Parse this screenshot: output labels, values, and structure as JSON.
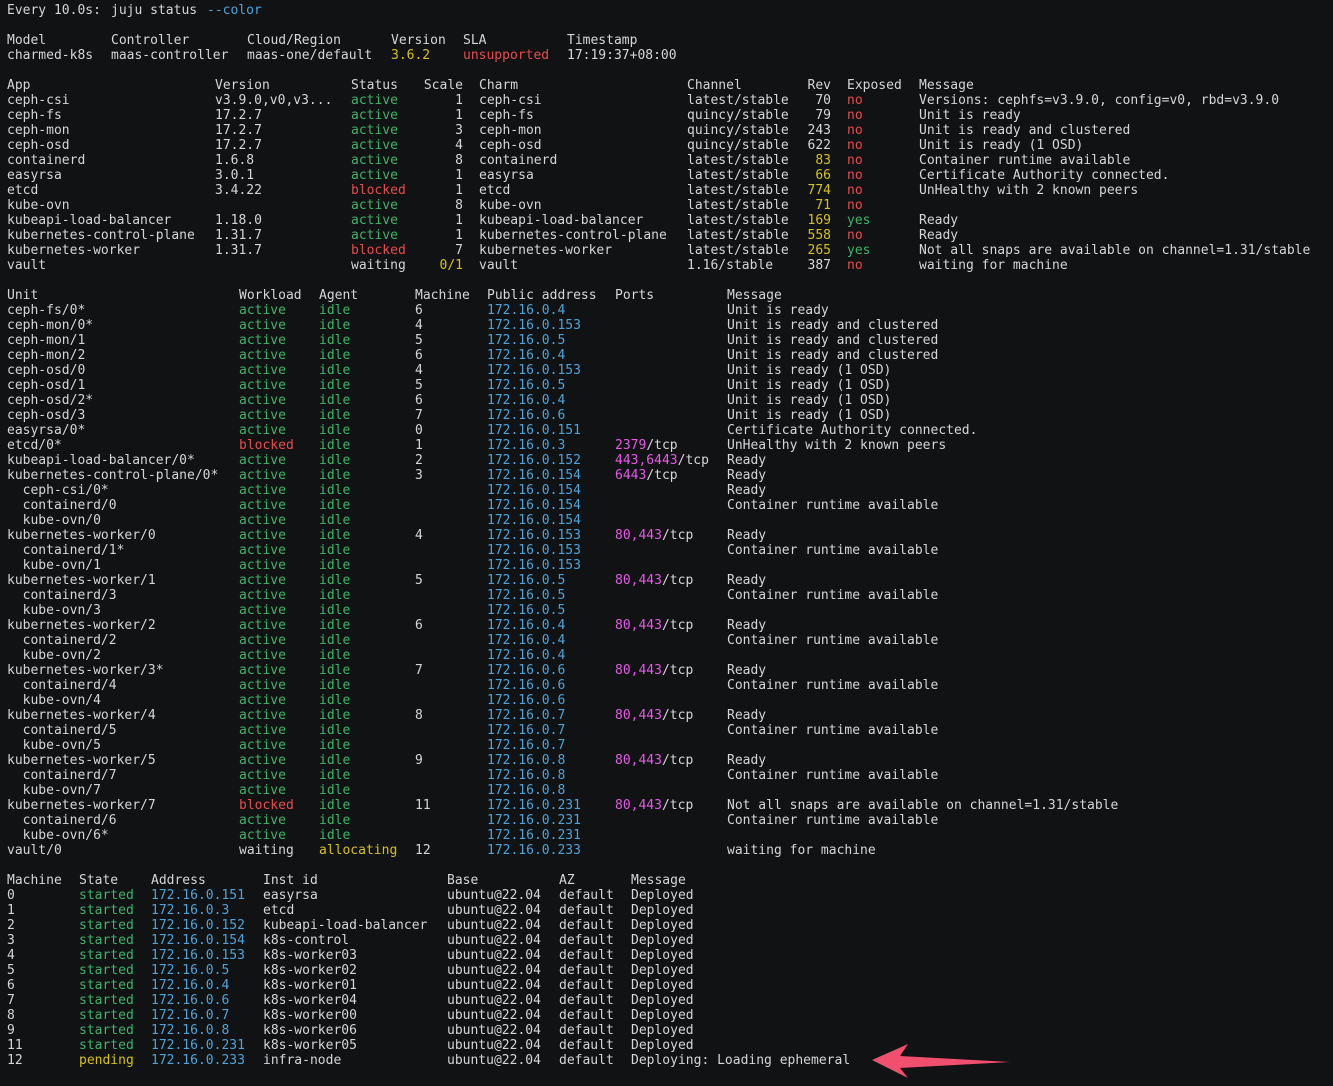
{
  "header": {
    "watch": "Every 10.0s: ",
    "command": "juju status ",
    "flag": "--color"
  },
  "model": {
    "headers": [
      "Model",
      "Controller",
      "Cloud/Region",
      "Version",
      "SLA",
      "Timestamp"
    ],
    "values": [
      "charmed-k8s",
      "maas-controller",
      "maas-one/default",
      "3.6.2",
      "unsupported",
      "17:19:37+08:00"
    ]
  },
  "apps": {
    "headers": [
      "App",
      "Version",
      "Status",
      "Scale",
      "Charm",
      "Channel",
      "Rev",
      "Exposed",
      "Message"
    ],
    "rows": [
      {
        "app": "ceph-csi",
        "version": "v3.9.0,v0,v3...",
        "status": "active",
        "scale": "1",
        "charm": "ceph-csi",
        "channel": "latest/stable",
        "rev": "70",
        "exposed": "no",
        "message": "Versions: cephfs=v3.9.0, config=v0, rbd=v3.9.0"
      },
      {
        "app": "ceph-fs",
        "version": "17.2.7",
        "status": "active",
        "scale": "1",
        "charm": "ceph-fs",
        "channel": "quincy/stable",
        "rev": "79",
        "exposed": "no",
        "message": "Unit is ready"
      },
      {
        "app": "ceph-mon",
        "version": "17.2.7",
        "status": "active",
        "scale": "3",
        "charm": "ceph-mon",
        "channel": "quincy/stable",
        "rev": "243",
        "exposed": "no",
        "message": "Unit is ready and clustered"
      },
      {
        "app": "ceph-osd",
        "version": "17.2.7",
        "status": "active",
        "scale": "4",
        "charm": "ceph-osd",
        "channel": "quincy/stable",
        "rev": "622",
        "exposed": "no",
        "message": "Unit is ready (1 OSD)"
      },
      {
        "app": "containerd",
        "version": "1.6.8",
        "status": "active",
        "scale": "8",
        "charm": "containerd",
        "channel": "latest/stable",
        "rev": "83",
        "exposed": "no",
        "message": "Container runtime available"
      },
      {
        "app": "easyrsa",
        "version": "3.0.1",
        "status": "active",
        "scale": "1",
        "charm": "easyrsa",
        "channel": "latest/stable",
        "rev": "66",
        "exposed": "no",
        "message": "Certificate Authority connected."
      },
      {
        "app": "etcd",
        "version": "3.4.22",
        "status": "blocked",
        "scale": "1",
        "charm": "etcd",
        "channel": "latest/stable",
        "rev": "774",
        "exposed": "no",
        "message": "UnHealthy with 2 known peers"
      },
      {
        "app": "kube-ovn",
        "version": "",
        "status": "active",
        "scale": "8",
        "charm": "kube-ovn",
        "channel": "latest/stable",
        "rev": "71",
        "exposed": "no",
        "message": ""
      },
      {
        "app": "kubeapi-load-balancer",
        "version": "1.18.0",
        "status": "active",
        "scale": "1",
        "charm": "kubeapi-load-balancer",
        "channel": "latest/stable",
        "rev": "169",
        "exposed": "yes",
        "message": "Ready"
      },
      {
        "app": "kubernetes-control-plane",
        "version": "1.31.7",
        "status": "active",
        "scale": "1",
        "charm": "kubernetes-control-plane",
        "channel": "latest/stable",
        "rev": "558",
        "exposed": "no",
        "message": "Ready"
      },
      {
        "app": "kubernetes-worker",
        "version": "1.31.7",
        "status": "blocked",
        "scale": "7",
        "charm": "kubernetes-worker",
        "channel": "latest/stable",
        "rev": "265",
        "exposed": "yes",
        "message": "Not all snaps are available on channel=1.31/stable"
      },
      {
        "app": "vault",
        "version": "",
        "status": "waiting",
        "scale": "0/1",
        "charm": "vault",
        "channel": "1.16/stable",
        "rev": "387",
        "exposed": "no",
        "message": "waiting for machine"
      }
    ]
  },
  "units": {
    "headers": [
      "Unit",
      "Workload",
      "Agent",
      "Machine",
      "Public address",
      "Ports",
      "Message"
    ],
    "rows": [
      {
        "unit": "ceph-fs/0*",
        "workload": "active",
        "agent": "idle",
        "machine": "6",
        "address": "172.16.0.4",
        "ports_num": "",
        "ports_proto": "",
        "message": "Unit is ready"
      },
      {
        "unit": "ceph-mon/0*",
        "workload": "active",
        "agent": "idle",
        "machine": "4",
        "address": "172.16.0.153",
        "ports_num": "",
        "ports_proto": "",
        "message": "Unit is ready and clustered"
      },
      {
        "unit": "ceph-mon/1",
        "workload": "active",
        "agent": "idle",
        "machine": "5",
        "address": "172.16.0.5",
        "ports_num": "",
        "ports_proto": "",
        "message": "Unit is ready and clustered"
      },
      {
        "unit": "ceph-mon/2",
        "workload": "active",
        "agent": "idle",
        "machine": "6",
        "address": "172.16.0.4",
        "ports_num": "",
        "ports_proto": "",
        "message": "Unit is ready and clustered"
      },
      {
        "unit": "ceph-osd/0",
        "workload": "active",
        "agent": "idle",
        "machine": "4",
        "address": "172.16.0.153",
        "ports_num": "",
        "ports_proto": "",
        "message": "Unit is ready (1 OSD)"
      },
      {
        "unit": "ceph-osd/1",
        "workload": "active",
        "agent": "idle",
        "machine": "5",
        "address": "172.16.0.5",
        "ports_num": "",
        "ports_proto": "",
        "message": "Unit is ready (1 OSD)"
      },
      {
        "unit": "ceph-osd/2*",
        "workload": "active",
        "agent": "idle",
        "machine": "6",
        "address": "172.16.0.4",
        "ports_num": "",
        "ports_proto": "",
        "message": "Unit is ready (1 OSD)"
      },
      {
        "unit": "ceph-osd/3",
        "workload": "active",
        "agent": "idle",
        "machine": "7",
        "address": "172.16.0.6",
        "ports_num": "",
        "ports_proto": "",
        "message": "Unit is ready (1 OSD)"
      },
      {
        "unit": "easyrsa/0*",
        "workload": "active",
        "agent": "idle",
        "machine": "0",
        "address": "172.16.0.151",
        "ports_num": "",
        "ports_proto": "",
        "message": "Certificate Authority connected."
      },
      {
        "unit": "etcd/0*",
        "workload": "blocked",
        "agent": "idle",
        "machine": "1",
        "address": "172.16.0.3",
        "ports_num": "2379",
        "ports_proto": "/tcp",
        "message": "UnHealthy with 2 known peers"
      },
      {
        "unit": "kubeapi-load-balancer/0*",
        "workload": "active",
        "agent": "idle",
        "machine": "2",
        "address": "172.16.0.152",
        "ports_num": "443,6443",
        "ports_proto": "/tcp",
        "message": "Ready"
      },
      {
        "unit": "kubernetes-control-plane/0*",
        "workload": "active",
        "agent": "idle",
        "machine": "3",
        "address": "172.16.0.154",
        "ports_num": "6443",
        "ports_proto": "/tcp",
        "message": "Ready"
      },
      {
        "unit": "  ceph-csi/0*",
        "workload": "active",
        "agent": "idle",
        "machine": "",
        "address": "172.16.0.154",
        "ports_num": "",
        "ports_proto": "",
        "message": "Ready"
      },
      {
        "unit": "  containerd/0",
        "workload": "active",
        "agent": "idle",
        "machine": "",
        "address": "172.16.0.154",
        "ports_num": "",
        "ports_proto": "",
        "message": "Container runtime available"
      },
      {
        "unit": "  kube-ovn/0",
        "workload": "active",
        "agent": "idle",
        "machine": "",
        "address": "172.16.0.154",
        "ports_num": "",
        "ports_proto": "",
        "message": ""
      },
      {
        "unit": "kubernetes-worker/0",
        "workload": "active",
        "agent": "idle",
        "machine": "4",
        "address": "172.16.0.153",
        "ports_num": "80,443",
        "ports_proto": "/tcp",
        "message": "Ready"
      },
      {
        "unit": "  containerd/1*",
        "workload": "active",
        "agent": "idle",
        "machine": "",
        "address": "172.16.0.153",
        "ports_num": "",
        "ports_proto": "",
        "message": "Container runtime available"
      },
      {
        "unit": "  kube-ovn/1",
        "workload": "active",
        "agent": "idle",
        "machine": "",
        "address": "172.16.0.153",
        "ports_num": "",
        "ports_proto": "",
        "message": ""
      },
      {
        "unit": "kubernetes-worker/1",
        "workload": "active",
        "agent": "idle",
        "machine": "5",
        "address": "172.16.0.5",
        "ports_num": "80,443",
        "ports_proto": "/tcp",
        "message": "Ready"
      },
      {
        "unit": "  containerd/3",
        "workload": "active",
        "agent": "idle",
        "machine": "",
        "address": "172.16.0.5",
        "ports_num": "",
        "ports_proto": "",
        "message": "Container runtime available"
      },
      {
        "unit": "  kube-ovn/3",
        "workload": "active",
        "agent": "idle",
        "machine": "",
        "address": "172.16.0.5",
        "ports_num": "",
        "ports_proto": "",
        "message": ""
      },
      {
        "unit": "kubernetes-worker/2",
        "workload": "active",
        "agent": "idle",
        "machine": "6",
        "address": "172.16.0.4",
        "ports_num": "80,443",
        "ports_proto": "/tcp",
        "message": "Ready"
      },
      {
        "unit": "  containerd/2",
        "workload": "active",
        "agent": "idle",
        "machine": "",
        "address": "172.16.0.4",
        "ports_num": "",
        "ports_proto": "",
        "message": "Container runtime available"
      },
      {
        "unit": "  kube-ovn/2",
        "workload": "active",
        "agent": "idle",
        "machine": "",
        "address": "172.16.0.4",
        "ports_num": "",
        "ports_proto": "",
        "message": ""
      },
      {
        "unit": "kubernetes-worker/3*",
        "workload": "active",
        "agent": "idle",
        "machine": "7",
        "address": "172.16.0.6",
        "ports_num": "80,443",
        "ports_proto": "/tcp",
        "message": "Ready"
      },
      {
        "unit": "  containerd/4",
        "workload": "active",
        "agent": "idle",
        "machine": "",
        "address": "172.16.0.6",
        "ports_num": "",
        "ports_proto": "",
        "message": "Container runtime available"
      },
      {
        "unit": "  kube-ovn/4",
        "workload": "active",
        "agent": "idle",
        "machine": "",
        "address": "172.16.0.6",
        "ports_num": "",
        "ports_proto": "",
        "message": ""
      },
      {
        "unit": "kubernetes-worker/4",
        "workload": "active",
        "agent": "idle",
        "machine": "8",
        "address": "172.16.0.7",
        "ports_num": "80,443",
        "ports_proto": "/tcp",
        "message": "Ready"
      },
      {
        "unit": "  containerd/5",
        "workload": "active",
        "agent": "idle",
        "machine": "",
        "address": "172.16.0.7",
        "ports_num": "",
        "ports_proto": "",
        "message": "Container runtime available"
      },
      {
        "unit": "  kube-ovn/5",
        "workload": "active",
        "agent": "idle",
        "machine": "",
        "address": "172.16.0.7",
        "ports_num": "",
        "ports_proto": "",
        "message": ""
      },
      {
        "unit": "kubernetes-worker/5",
        "workload": "active",
        "agent": "idle",
        "machine": "9",
        "address": "172.16.0.8",
        "ports_num": "80,443",
        "ports_proto": "/tcp",
        "message": "Ready"
      },
      {
        "unit": "  containerd/7",
        "workload": "active",
        "agent": "idle",
        "machine": "",
        "address": "172.16.0.8",
        "ports_num": "",
        "ports_proto": "",
        "message": "Container runtime available"
      },
      {
        "unit": "  kube-ovn/7",
        "workload": "active",
        "agent": "idle",
        "machine": "",
        "address": "172.16.0.8",
        "ports_num": "",
        "ports_proto": "",
        "message": ""
      },
      {
        "unit": "kubernetes-worker/7",
        "workload": "blocked",
        "agent": "idle",
        "machine": "11",
        "address": "172.16.0.231",
        "ports_num": "80,443",
        "ports_proto": "/tcp",
        "message": "Not all snaps are available on channel=1.31/stable"
      },
      {
        "unit": "  containerd/6",
        "workload": "active",
        "agent": "idle",
        "machine": "",
        "address": "172.16.0.231",
        "ports_num": "",
        "ports_proto": "",
        "message": "Container runtime available"
      },
      {
        "unit": "  kube-ovn/6*",
        "workload": "active",
        "agent": "idle",
        "machine": "",
        "address": "172.16.0.231",
        "ports_num": "",
        "ports_proto": "",
        "message": ""
      },
      {
        "unit": "vault/0",
        "workload": "waiting",
        "agent": "allocating",
        "machine": "12",
        "address": "172.16.0.233",
        "ports_num": "",
        "ports_proto": "",
        "message": "waiting for machine"
      }
    ]
  },
  "machines": {
    "headers": [
      "Machine",
      "State",
      "Address",
      "Inst id",
      "Base",
      "AZ",
      "Message"
    ],
    "rows": [
      {
        "machine": "0",
        "state": "started",
        "address": "172.16.0.151",
        "inst": "easyrsa",
        "base": "ubuntu@22.04",
        "az": "default",
        "message": "Deployed"
      },
      {
        "machine": "1",
        "state": "started",
        "address": "172.16.0.3",
        "inst": "etcd",
        "base": "ubuntu@22.04",
        "az": "default",
        "message": "Deployed"
      },
      {
        "machine": "2",
        "state": "started",
        "address": "172.16.0.152",
        "inst": "kubeapi-load-balancer",
        "base": "ubuntu@22.04",
        "az": "default",
        "message": "Deployed"
      },
      {
        "machine": "3",
        "state": "started",
        "address": "172.16.0.154",
        "inst": "k8s-control",
        "base": "ubuntu@22.04",
        "az": "default",
        "message": "Deployed"
      },
      {
        "machine": "4",
        "state": "started",
        "address": "172.16.0.153",
        "inst": "k8s-worker03",
        "base": "ubuntu@22.04",
        "az": "default",
        "message": "Deployed"
      },
      {
        "machine": "5",
        "state": "started",
        "address": "172.16.0.5",
        "inst": "k8s-worker02",
        "base": "ubuntu@22.04",
        "az": "default",
        "message": "Deployed"
      },
      {
        "machine": "6",
        "state": "started",
        "address": "172.16.0.4",
        "inst": "k8s-worker01",
        "base": "ubuntu@22.04",
        "az": "default",
        "message": "Deployed"
      },
      {
        "machine": "7",
        "state": "started",
        "address": "172.16.0.6",
        "inst": "k8s-worker04",
        "base": "ubuntu@22.04",
        "az": "default",
        "message": "Deployed"
      },
      {
        "machine": "8",
        "state": "started",
        "address": "172.16.0.7",
        "inst": "k8s-worker00",
        "base": "ubuntu@22.04",
        "az": "default",
        "message": "Deployed"
      },
      {
        "machine": "9",
        "state": "started",
        "address": "172.16.0.8",
        "inst": "k8s-worker06",
        "base": "ubuntu@22.04",
        "az": "default",
        "message": "Deployed"
      },
      {
        "machine": "11",
        "state": "started",
        "address": "172.16.0.231",
        "inst": "k8s-worker05",
        "base": "ubuntu@22.04",
        "az": "default",
        "message": "Deployed"
      },
      {
        "machine": "12",
        "state": "pending",
        "address": "172.16.0.233",
        "inst": "infra-node",
        "base": "ubuntu@22.04",
        "az": "default",
        "message": "Deploying: Loading ephemeral"
      }
    ]
  },
  "colors": {
    "background": "#111214",
    "text": "#d6d6d6",
    "active": "#3fb36a",
    "blocked": "#e74c4c",
    "waiting": "#d5c11b",
    "address": "#4fa3d8",
    "ports": "#e55ae6",
    "arrow": "#f0506e"
  },
  "annotation": {
    "icon": "red-arrow-icon"
  }
}
